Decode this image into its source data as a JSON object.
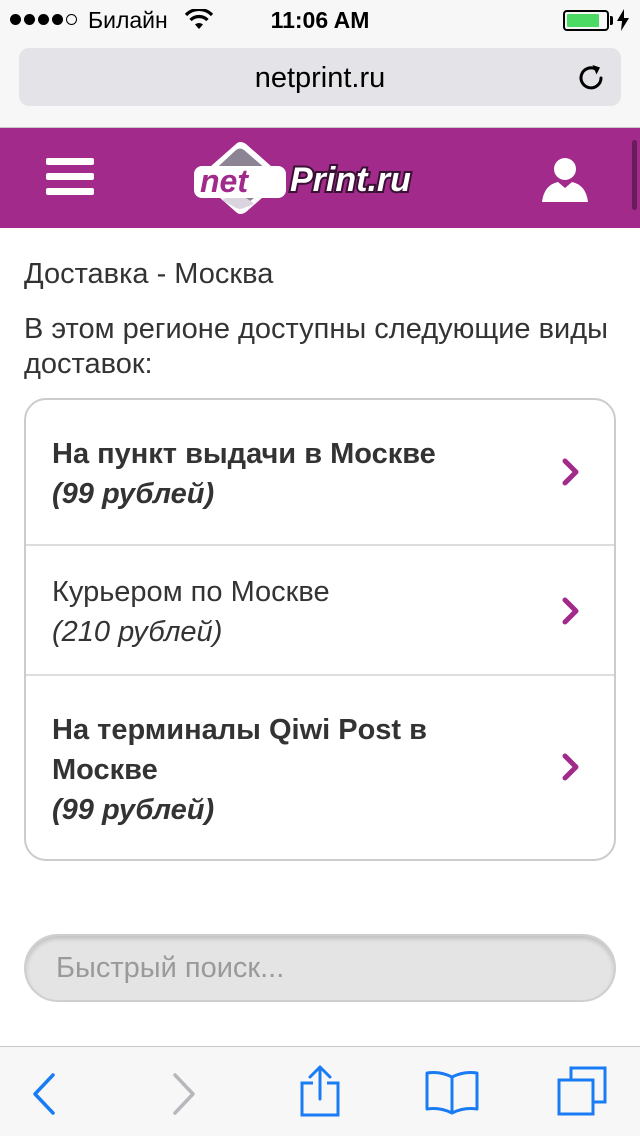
{
  "status_bar": {
    "carrier": "Билайн",
    "time": "11:06 AM",
    "signal_strength": 4,
    "signal_max": 5,
    "battery_level": 0.85,
    "battery_color": "#4cd964"
  },
  "browser": {
    "url": "netprint.ru",
    "reload_icon": "reload-icon"
  },
  "header": {
    "background": "#a12a8a",
    "logo_text_net": "net",
    "logo_text_print": "Print.ru",
    "menu_icon": "hamburger-menu-icon",
    "user_icon": "user-icon"
  },
  "content": {
    "title": "Доставка - Москва",
    "intro": "В этом регионе доступны следующие виды доставок:",
    "delivery_options": [
      {
        "name": "На пункт выдачи в Москве",
        "price": "(99 рублей)",
        "bold": true
      },
      {
        "name": "Курьером по Москве",
        "price": "(210 рублей)",
        "bold": false
      },
      {
        "name": "На терминалы Qiwi Post в Москве",
        "price": "(99 рублей)",
        "bold": true
      }
    ],
    "accent_color": "#a12a8a"
  },
  "search": {
    "placeholder": "Быстрый поиск..."
  },
  "toolbar": {
    "accent_color": "#1a7cf5",
    "items": [
      "back-icon",
      "forward-icon",
      "share-icon",
      "bookmarks-icon",
      "tabs-icon"
    ]
  }
}
